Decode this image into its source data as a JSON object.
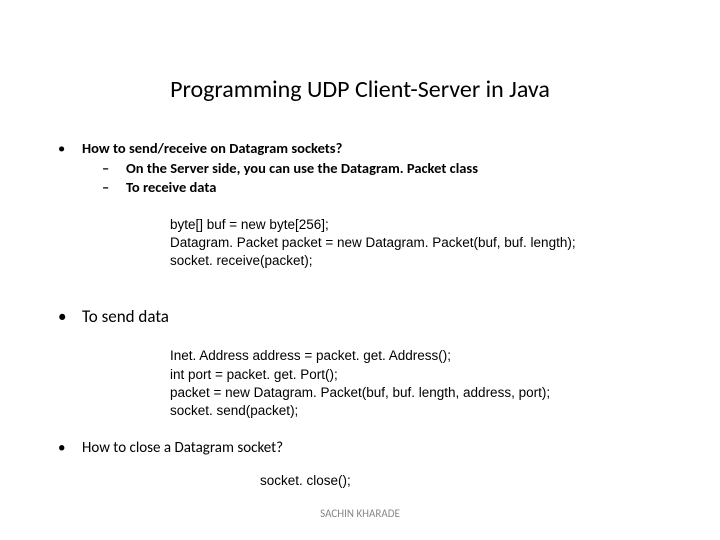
{
  "title": "Programming UDP Client-Server in Java",
  "bullet1": {
    "text": "How to send/receive on Datagram sockets?",
    "sub1": "On the Server side, you can use the Datagram. Packet class",
    "sub2": "To receive data"
  },
  "code1": {
    "l1": "byte[] buf = new byte[256];",
    "l2": "Datagram. Packet packet = new Datagram. Packet(buf, buf. length);",
    "l3": "socket. receive(packet);"
  },
  "bullet2": "To send data",
  "code2": {
    "l1": "Inet. Address address = packet. get. Address();",
    "l2": "int port = packet. get. Port();",
    "l3": "packet = new Datagram. Packet(buf, buf. length, address, port);",
    "l4": "socket. send(packet);"
  },
  "bullet3": "How to close a Datagram socket?",
  "code3": {
    "l1": "socket. close();"
  },
  "footer": "SACHIN KHARADE"
}
